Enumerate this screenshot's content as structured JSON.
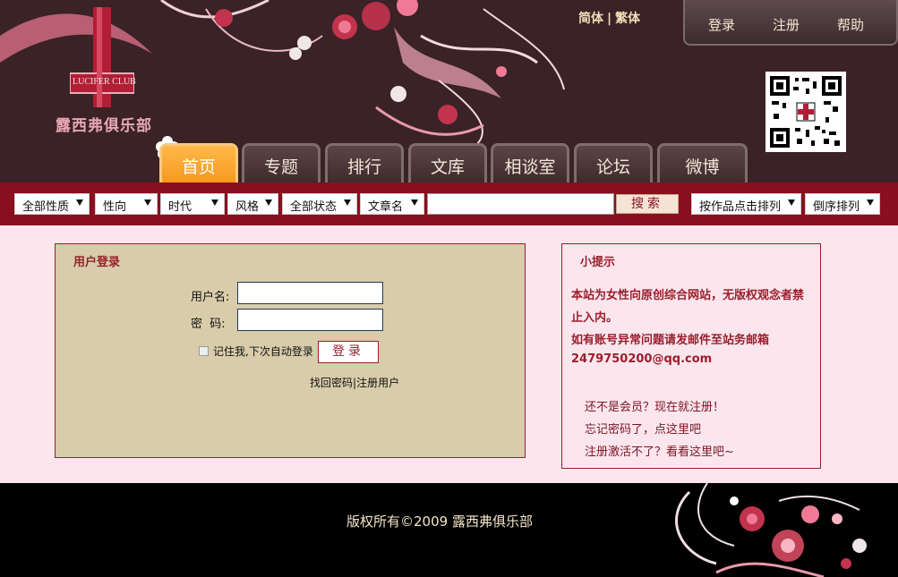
{
  "header": {
    "logo_text": "LUCIFER CLUB",
    "site_name": "露西弗俱乐部",
    "lang_simplified": "简体",
    "lang_separator": "|",
    "lang_traditional": "繁体",
    "top_links": {
      "login": "登录",
      "register": "注册",
      "help": "帮助"
    }
  },
  "nav": {
    "tabs": [
      "首页",
      "专题",
      "排行",
      "文库",
      "相谈室",
      "论坛",
      "微博"
    ],
    "active_index": 0
  },
  "search": {
    "filters": [
      "全部性质",
      "性向",
      "时代",
      "风格",
      "全部状态",
      "文章名"
    ],
    "query": "",
    "button": "搜索",
    "sort_by": "按作品点击排列",
    "order": "倒序排列"
  },
  "login": {
    "title": "用户登录",
    "username_label": "用户名:",
    "password_label": "密  码:",
    "username_value": "",
    "password_value": "",
    "remember_label": "记住我,下次自动登录",
    "submit": "登录",
    "find_password": "找回密码",
    "link_separator": "|",
    "register_user": "注册用户"
  },
  "tips": {
    "title": "小提示",
    "line1": "本站为女性向原创综合网站，无版权观念者禁",
    "line2": "止入内。",
    "line3": "如有账号异常问题请发邮件至站务邮箱",
    "email": "2479750200@qq.com",
    "link1": "还不是会员？现在就注册！",
    "link2": "忘记密码了，点这里吧",
    "link3": "注册激活不了？看看这里吧~"
  },
  "footer": {
    "copyright": "版权所有©2009 露西弗俱乐部"
  },
  "colors": {
    "header_bg": "#3a2226",
    "accent_red": "#8a0f1e",
    "tab_active": "#f59a1f",
    "page_bg": "#fbe6ee",
    "login_bg": "#d8ccaa"
  }
}
